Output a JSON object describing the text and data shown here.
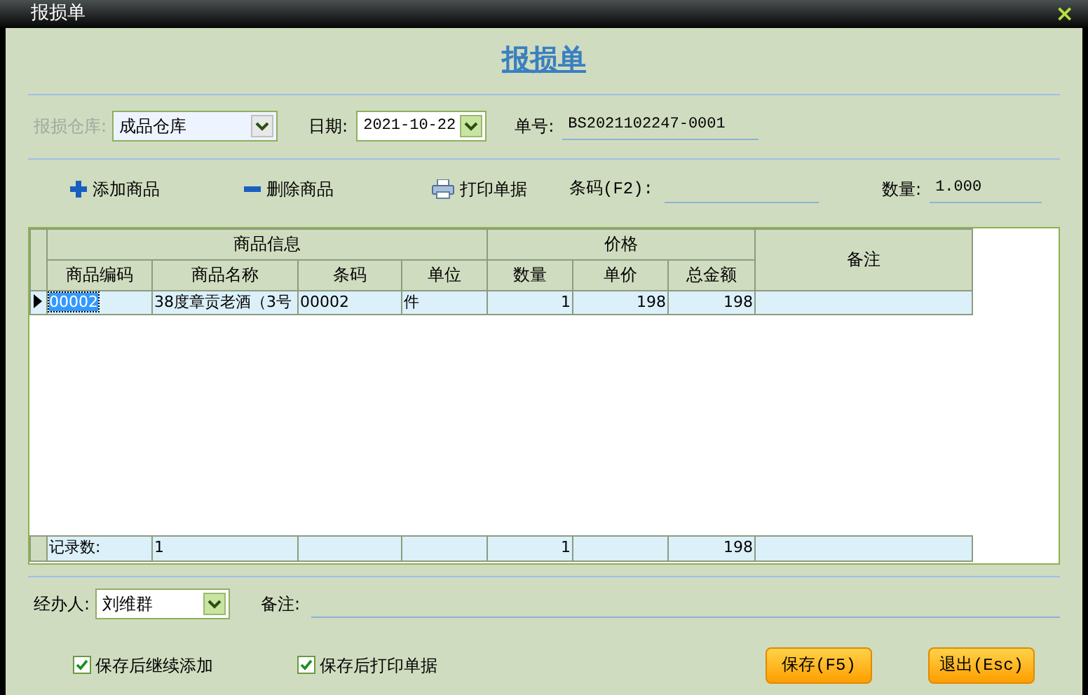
{
  "window": {
    "title": "报损单",
    "close": "×"
  },
  "form_title": "报损单",
  "warehouse": {
    "label": "报损仓库:",
    "value": "成品仓库",
    "disabled": true
  },
  "date": {
    "label": "日期:",
    "value": "2021-10-22"
  },
  "order_no": {
    "label": "单号:",
    "value": "BS2021102247-0001"
  },
  "toolbar": [
    {
      "kind": "add",
      "label": "添加商品"
    },
    {
      "kind": "remove",
      "label": "删除商品"
    },
    {
      "kind": "print",
      "label": "打印单据"
    }
  ],
  "barcode": {
    "label": "条码(F2):"
  },
  "quantity": {
    "label": "数量:",
    "value": "1.000"
  },
  "table": {
    "groups": [
      {
        "label": "商品信息",
        "columns": [
          {
            "label": "商品编码",
            "footer": "记录数:"
          },
          {
            "label": "商品名称",
            "footer": "1"
          },
          {
            "label": "条码"
          },
          {
            "label": "单位"
          }
        ]
      },
      {
        "label": "价格",
        "columns": [
          {
            "label": "数量",
            "footer": "1"
          },
          {
            "label": "单价"
          },
          {
            "label": "总金额",
            "footer": "198"
          }
        ]
      },
      {
        "label": "备注"
      }
    ],
    "rows": [
      {
        "selected": true,
        "cells": [
          "00002",
          "38度章贡老酒（3号",
          "00002",
          "件",
          "1",
          "198",
          "198"
        ]
      }
    ]
  },
  "handler": {
    "label": "经办人:",
    "value": "刘维群"
  },
  "remark": {
    "label": "备注:"
  },
  "options": [
    {
      "label": "保存后继续添加",
      "checked": true
    },
    {
      "label": "保存后打印单据",
      "checked": true
    }
  ],
  "buttons": [
    {
      "label": "保存(F5)"
    },
    {
      "label": "退出(Esc)"
    }
  ]
}
